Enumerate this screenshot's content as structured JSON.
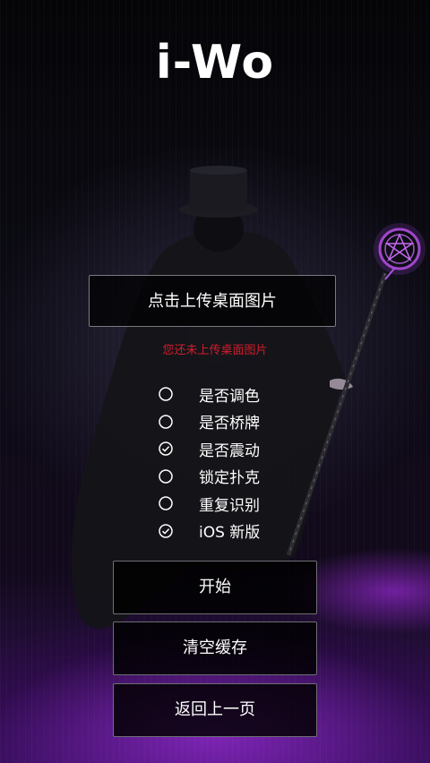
{
  "app": {
    "logo_text": "i-Wo"
  },
  "upload": {
    "label": "点击上传桌面图片",
    "status": "您还未上传桌面图片"
  },
  "options": [
    {
      "label": "是否调色",
      "checked": false
    },
    {
      "label": "是否桥牌",
      "checked": false
    },
    {
      "label": "是否震动",
      "checked": true
    },
    {
      "label": "锁定扑克",
      "checked": false
    },
    {
      "label": "重复识别",
      "checked": false
    },
    {
      "label": "iOS 新版",
      "checked": true
    }
  ],
  "actions": {
    "start_label": "开始",
    "clear_cache_label": "清空缓存",
    "back_label": "返回上一页"
  },
  "colors": {
    "warning": "#d11d2a",
    "accent_purple": "#9b3fd6"
  }
}
